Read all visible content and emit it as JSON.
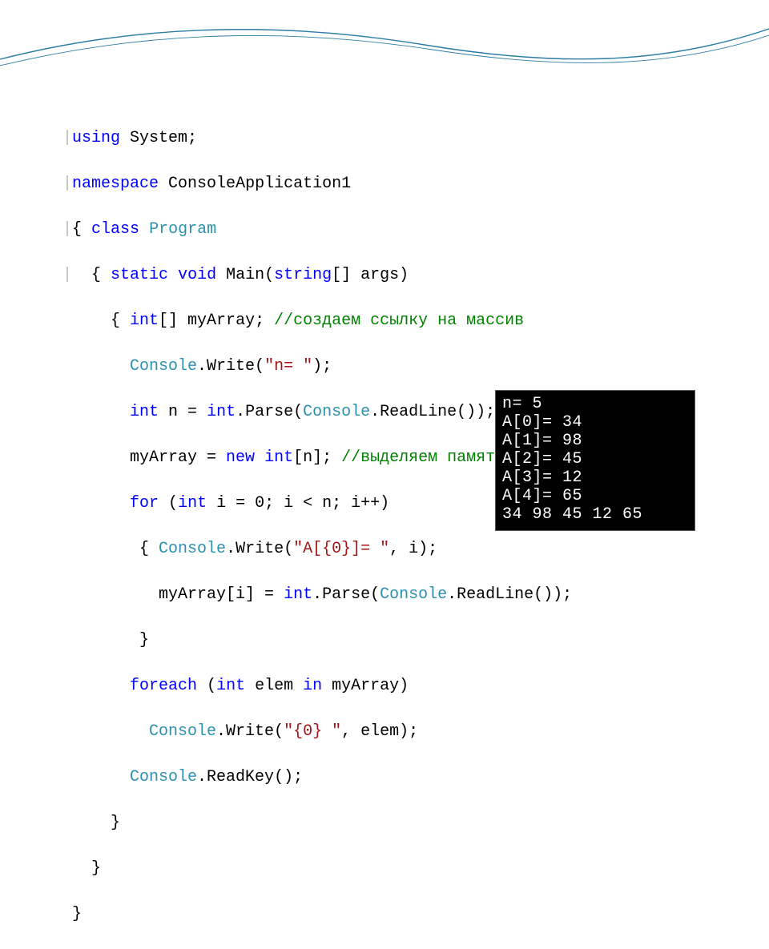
{
  "code": {
    "l1": {
      "kw1": "using",
      "txt": " System;"
    },
    "l2": {
      "kw1": "namespace",
      "txt": " ConsoleApplication1"
    },
    "l3": {
      "txt1": "{ ",
      "kw1": "class",
      "txt2": " ",
      "typ1": "Program"
    },
    "l4": {
      "txt1": "  { ",
      "kw1": "static",
      "txt2": " ",
      "kw2": "void",
      "txt3": " Main(",
      "kw3": "string",
      "txt4": "[] args)"
    },
    "l5": {
      "txt1": "    { ",
      "kw1": "int",
      "txt2": "[] myArray; ",
      "cmt": "//создаем ссылку на массив"
    },
    "l6": {
      "txt1": "      ",
      "typ1": "Console",
      "txt2": ".Write(",
      "str": "\"n= \"",
      "txt3": ");"
    },
    "l7": {
      "txt1": "      ",
      "kw1": "int",
      "txt2": " n = ",
      "kw2": "int",
      "txt3": ".Parse(",
      "typ1": "Console",
      "txt4": ".ReadLine());"
    },
    "l8": {
      "txt1": "      myArray = ",
      "kw1": "new",
      "txt2": " ",
      "kw2": "int",
      "txt3": "[n]; ",
      "cmt": "//выделяем память под массив"
    },
    "l9": {
      "txt1": "      ",
      "kw1": "for",
      "txt2": " (",
      "kw2": "int",
      "txt3": " i = 0; i < n; i++)"
    },
    "l10": {
      "txt1": "       { ",
      "typ1": "Console",
      "txt2": ".Write(",
      "str": "\"A[{0}]= \"",
      "txt3": ", i);"
    },
    "l11": {
      "txt1": "         myArray[i] = ",
      "kw1": "int",
      "txt2": ".Parse(",
      "typ1": "Console",
      "txt3": ".ReadLine());"
    },
    "l12": {
      "txt": "       }"
    },
    "l13": {
      "txt1": "      ",
      "kw1": "foreach",
      "txt2": " (",
      "kw2": "int",
      "txt3": " elem ",
      "kw3": "in",
      "txt4": " myArray)"
    },
    "l14": {
      "txt1": "        ",
      "typ1": "Console",
      "txt2": ".Write(",
      "str": "\"{0} \"",
      "txt3": ", elem);"
    },
    "l15": {
      "txt1": "      ",
      "typ1": "Console",
      "txt2": ".ReadKey();"
    },
    "l16": {
      "txt": "    }"
    },
    "l17": {
      "txt": "  }"
    },
    "l18": {
      "txt": "}"
    }
  },
  "console": {
    "l1": "n= 5",
    "l2": "A[0]= 34",
    "l3": "A[1]= 98",
    "l4": "A[2]= 45",
    "l5": "A[3]= 12",
    "l6": "A[4]= 65",
    "l7": "34 98 45 12 65"
  }
}
